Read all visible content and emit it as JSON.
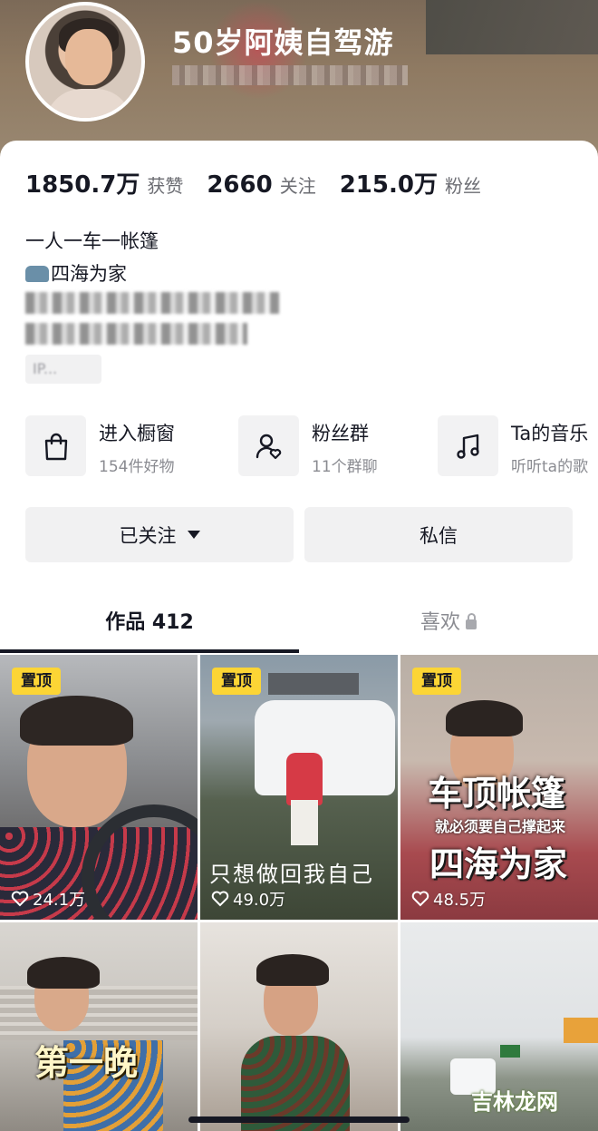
{
  "profile": {
    "nickname": "50岁阿姨自驾游",
    "stats": [
      {
        "num": "1850.7万",
        "label": "获赞"
      },
      {
        "num": "2660",
        "label": "关注"
      },
      {
        "num": "215.0万",
        "label": "粉丝"
      }
    ],
    "bio_line1": "一人一车一帐篷",
    "bio_line2": "四海为家",
    "ip_label": "IP..."
  },
  "entries": [
    {
      "title": "进入橱窗",
      "sub": "154件好物",
      "icon": "shopping-bag-icon"
    },
    {
      "title": "粉丝群",
      "sub": "11个群聊",
      "icon": "fan-group-icon"
    },
    {
      "title": "Ta的音乐",
      "sub": "听听ta的歌",
      "icon": "music-note-icon"
    }
  ],
  "actions": {
    "follow_label": "已关注",
    "message_label": "私信"
  },
  "tabs": {
    "works": "作品 412",
    "likes": "喜欢"
  },
  "grid": [
    {
      "pinned": "置顶",
      "likes": "24.1万",
      "caption": ""
    },
    {
      "pinned": "置顶",
      "likes": "49.0万",
      "caption": "只想做回我自己"
    },
    {
      "pinned": "置顶",
      "likes": "48.5万",
      "caption_big": "车顶帐篷",
      "caption_small": "就必须要自己撑起来",
      "caption_big2": "四海为家"
    },
    {
      "caption": "第一晚"
    },
    {
      "caption": ""
    },
    {
      "caption": ""
    }
  ],
  "watermark": "吉林龙网",
  "colors": {
    "pin_badge": "#fcd535",
    "text_primary": "#161823",
    "text_secondary": "#8a8b91",
    "button_bg": "#f1f1f2"
  }
}
